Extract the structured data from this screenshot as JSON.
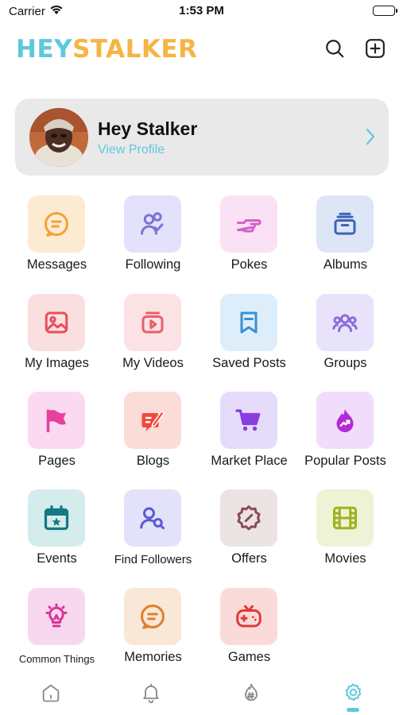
{
  "status_bar": {
    "carrier": "Carrier",
    "time": "1:53 PM"
  },
  "header": {
    "logo_part1": "HEY",
    "logo_part2": "STALKER",
    "search_icon": "search-icon",
    "add_icon": "plus-square-icon"
  },
  "profile": {
    "name": "Hey Stalker",
    "link": "View Profile"
  },
  "menu": [
    {
      "label": "Messages",
      "icon": "message-icon",
      "bg": "#fdebd1",
      "fg": "#f2a23b"
    },
    {
      "label": "Following",
      "icon": "user-check-icon",
      "bg": "#e4e1fb",
      "fg": "#7a74d6"
    },
    {
      "label": "Pokes",
      "icon": "hand-point-icon",
      "bg": "#fbe1f4",
      "fg": "#d462c9"
    },
    {
      "label": "Albums",
      "icon": "album-icon",
      "bg": "#dde6f7",
      "fg": "#3d63b8"
    },
    {
      "label": "My Images",
      "icon": "image-icon",
      "bg": "#fadfe0",
      "fg": "#e4505b"
    },
    {
      "label": "My Videos",
      "icon": "video-icon",
      "bg": "#fbe2e4",
      "fg": "#ea5f6a"
    },
    {
      "label": "Saved Posts",
      "icon": "bookmark-icon",
      "bg": "#ddeefa",
      "fg": "#3a8fd2"
    },
    {
      "label": "Groups",
      "icon": "group-icon",
      "bg": "#e8e2fb",
      "fg": "#8a6cd8"
    },
    {
      "label": "Pages",
      "icon": "flag-icon",
      "bg": "#fbd9f1",
      "fg": "#e83f9d"
    },
    {
      "label": "Blogs",
      "icon": "blog-edit-icon",
      "bg": "#fcdcd7",
      "fg": "#ef4a3b"
    },
    {
      "label": "Market Place",
      "icon": "cart-icon",
      "bg": "#e5dcfb",
      "fg": "#8a3ce0"
    },
    {
      "label": "Popular Posts",
      "icon": "flame-icon",
      "bg": "#f2dcfb",
      "fg": "#b42ad6"
    },
    {
      "label": "Events",
      "icon": "calendar-icon",
      "bg": "#d5ecec",
      "fg": "#137a85"
    },
    {
      "label": "Find Followers",
      "icon": "user-search-icon",
      "bg": "#e2e3fb",
      "fg": "#5a5ad2"
    },
    {
      "label": "Offers",
      "icon": "offer-badge-icon",
      "bg": "#ece3e5",
      "fg": "#8c4a58"
    },
    {
      "label": "Movies",
      "icon": "film-icon",
      "bg": "#eff3d6",
      "fg": "#9fb21d"
    },
    {
      "label": "Common Things",
      "icon": "lightbulb-icon",
      "bg": "#f8d8ee",
      "fg": "#d8349c"
    },
    {
      "label": "Memories",
      "icon": "memories-icon",
      "bg": "#f9e7d8",
      "fg": "#e07f2a"
    },
    {
      "label": "Games",
      "icon": "gamepad-icon",
      "bg": "#fbdbd9",
      "fg": "#e03a3a"
    }
  ],
  "nav": [
    {
      "name": "home-icon"
    },
    {
      "name": "bell-icon"
    },
    {
      "name": "hashtag-fire-icon"
    },
    {
      "name": "settings-gear-icon"
    }
  ],
  "colors": {
    "accent": "#5ec8dc",
    "logo_yellow": "#f6b443"
  }
}
